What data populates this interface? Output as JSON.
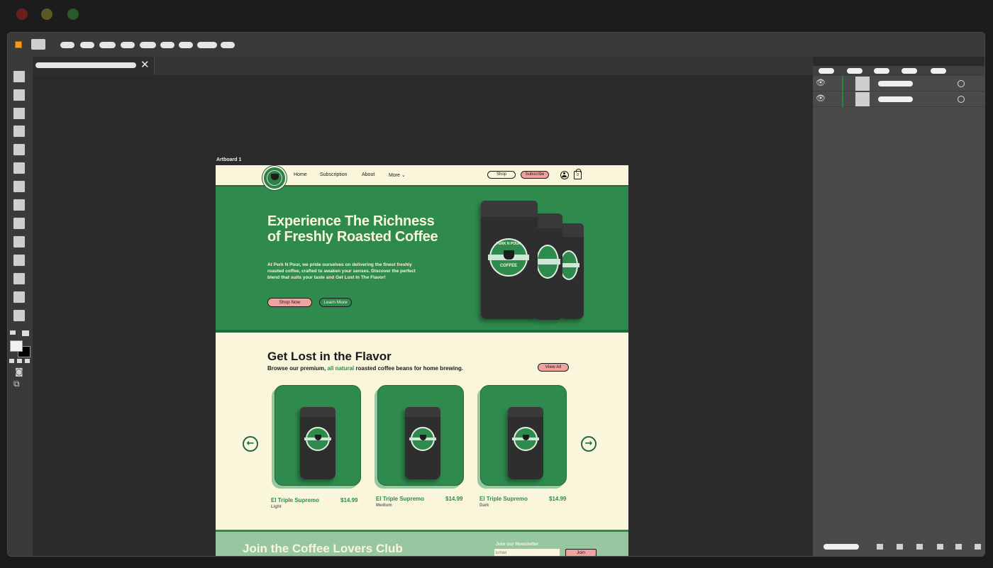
{
  "window": {
    "traffic_lights": [
      "close",
      "minimize",
      "zoom"
    ]
  },
  "canvas": {
    "artboard_label": "Artboard 1"
  },
  "site": {
    "nav": {
      "links": [
        "Home",
        "Subscription",
        "About",
        "More"
      ],
      "shop_label": "Shop",
      "subscribe_label": "Subscribe",
      "cart_count": "0"
    },
    "hero": {
      "title": "Experience The Richness of Freshly Roasted Coffee",
      "body": "At Perk N Pour, we pride ourselves on delivering the finest freshly roasted coffee, crafted to awaken your senses. Discover the perfect blend that suits your taste and Get Lost In The Flavor!",
      "shop_now_label": "Shop Now",
      "learn_more_label": "Learn More",
      "bag_brand_top": "PERK N POUR",
      "bag_brand_bottom": "COFFEE"
    },
    "products": {
      "title": "Get Lost in the Flavor",
      "subtitle_before": "Browse our premium, ",
      "subtitle_highlight": "all natural",
      "subtitle_after": " roasted coffee beans for home brewing.",
      "view_all_label": "View All",
      "items": [
        {
          "name": "El Triple Supremo",
          "price": "$14.99",
          "roast": "Light"
        },
        {
          "name": "El Triple Supremo",
          "price": "$14.99",
          "roast": "Medium"
        },
        {
          "name": "El Triple Supremo",
          "price": "$14.99",
          "roast": "Dark"
        }
      ]
    },
    "club": {
      "title": "Join the Coffee Lovers Club",
      "newsletter_label": "Join our Newsletter",
      "email_placeholder": "Email",
      "join_label": "Join"
    }
  },
  "colors": {
    "brand_green": "#2f8a4e",
    "cream": "#f9f6dc",
    "pink_button": "#f0a39e",
    "light_green": "#96c7a0"
  },
  "icons": [
    "eye-icon",
    "target-circle-icon",
    "close-icon",
    "user-icon",
    "cart-icon",
    "arrow-left-icon",
    "arrow-right-icon",
    "chevron-down-icon"
  ]
}
